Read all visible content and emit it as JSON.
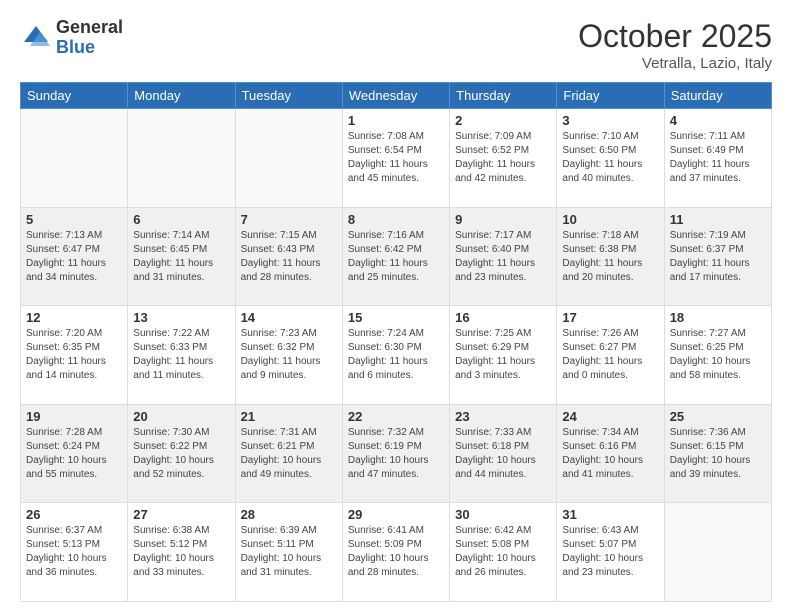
{
  "logo": {
    "general": "General",
    "blue": "Blue"
  },
  "title": "October 2025",
  "location": "Vetralla, Lazio, Italy",
  "weekdays": [
    "Sunday",
    "Monday",
    "Tuesday",
    "Wednesday",
    "Thursday",
    "Friday",
    "Saturday"
  ],
  "weeks": [
    [
      {
        "day": "",
        "info": ""
      },
      {
        "day": "",
        "info": ""
      },
      {
        "day": "",
        "info": ""
      },
      {
        "day": "1",
        "info": "Sunrise: 7:08 AM\nSunset: 6:54 PM\nDaylight: 11 hours and 45 minutes."
      },
      {
        "day": "2",
        "info": "Sunrise: 7:09 AM\nSunset: 6:52 PM\nDaylight: 11 hours and 42 minutes."
      },
      {
        "day": "3",
        "info": "Sunrise: 7:10 AM\nSunset: 6:50 PM\nDaylight: 11 hours and 40 minutes."
      },
      {
        "day": "4",
        "info": "Sunrise: 7:11 AM\nSunset: 6:49 PM\nDaylight: 11 hours and 37 minutes."
      }
    ],
    [
      {
        "day": "5",
        "info": "Sunrise: 7:13 AM\nSunset: 6:47 PM\nDaylight: 11 hours and 34 minutes."
      },
      {
        "day": "6",
        "info": "Sunrise: 7:14 AM\nSunset: 6:45 PM\nDaylight: 11 hours and 31 minutes."
      },
      {
        "day": "7",
        "info": "Sunrise: 7:15 AM\nSunset: 6:43 PM\nDaylight: 11 hours and 28 minutes."
      },
      {
        "day": "8",
        "info": "Sunrise: 7:16 AM\nSunset: 6:42 PM\nDaylight: 11 hours and 25 minutes."
      },
      {
        "day": "9",
        "info": "Sunrise: 7:17 AM\nSunset: 6:40 PM\nDaylight: 11 hours and 23 minutes."
      },
      {
        "day": "10",
        "info": "Sunrise: 7:18 AM\nSunset: 6:38 PM\nDaylight: 11 hours and 20 minutes."
      },
      {
        "day": "11",
        "info": "Sunrise: 7:19 AM\nSunset: 6:37 PM\nDaylight: 11 hours and 17 minutes."
      }
    ],
    [
      {
        "day": "12",
        "info": "Sunrise: 7:20 AM\nSunset: 6:35 PM\nDaylight: 11 hours and 14 minutes."
      },
      {
        "day": "13",
        "info": "Sunrise: 7:22 AM\nSunset: 6:33 PM\nDaylight: 11 hours and 11 minutes."
      },
      {
        "day": "14",
        "info": "Sunrise: 7:23 AM\nSunset: 6:32 PM\nDaylight: 11 hours and 9 minutes."
      },
      {
        "day": "15",
        "info": "Sunrise: 7:24 AM\nSunset: 6:30 PM\nDaylight: 11 hours and 6 minutes."
      },
      {
        "day": "16",
        "info": "Sunrise: 7:25 AM\nSunset: 6:29 PM\nDaylight: 11 hours and 3 minutes."
      },
      {
        "day": "17",
        "info": "Sunrise: 7:26 AM\nSunset: 6:27 PM\nDaylight: 11 hours and 0 minutes."
      },
      {
        "day": "18",
        "info": "Sunrise: 7:27 AM\nSunset: 6:25 PM\nDaylight: 10 hours and 58 minutes."
      }
    ],
    [
      {
        "day": "19",
        "info": "Sunrise: 7:28 AM\nSunset: 6:24 PM\nDaylight: 10 hours and 55 minutes."
      },
      {
        "day": "20",
        "info": "Sunrise: 7:30 AM\nSunset: 6:22 PM\nDaylight: 10 hours and 52 minutes."
      },
      {
        "day": "21",
        "info": "Sunrise: 7:31 AM\nSunset: 6:21 PM\nDaylight: 10 hours and 49 minutes."
      },
      {
        "day": "22",
        "info": "Sunrise: 7:32 AM\nSunset: 6:19 PM\nDaylight: 10 hours and 47 minutes."
      },
      {
        "day": "23",
        "info": "Sunrise: 7:33 AM\nSunset: 6:18 PM\nDaylight: 10 hours and 44 minutes."
      },
      {
        "day": "24",
        "info": "Sunrise: 7:34 AM\nSunset: 6:16 PM\nDaylight: 10 hours and 41 minutes."
      },
      {
        "day": "25",
        "info": "Sunrise: 7:36 AM\nSunset: 6:15 PM\nDaylight: 10 hours and 39 minutes."
      }
    ],
    [
      {
        "day": "26",
        "info": "Sunrise: 6:37 AM\nSunset: 5:13 PM\nDaylight: 10 hours and 36 minutes."
      },
      {
        "day": "27",
        "info": "Sunrise: 6:38 AM\nSunset: 5:12 PM\nDaylight: 10 hours and 33 minutes."
      },
      {
        "day": "28",
        "info": "Sunrise: 6:39 AM\nSunset: 5:11 PM\nDaylight: 10 hours and 31 minutes."
      },
      {
        "day": "29",
        "info": "Sunrise: 6:41 AM\nSunset: 5:09 PM\nDaylight: 10 hours and 28 minutes."
      },
      {
        "day": "30",
        "info": "Sunrise: 6:42 AM\nSunset: 5:08 PM\nDaylight: 10 hours and 26 minutes."
      },
      {
        "day": "31",
        "info": "Sunrise: 6:43 AM\nSunset: 5:07 PM\nDaylight: 10 hours and 23 minutes."
      },
      {
        "day": "",
        "info": ""
      }
    ]
  ]
}
